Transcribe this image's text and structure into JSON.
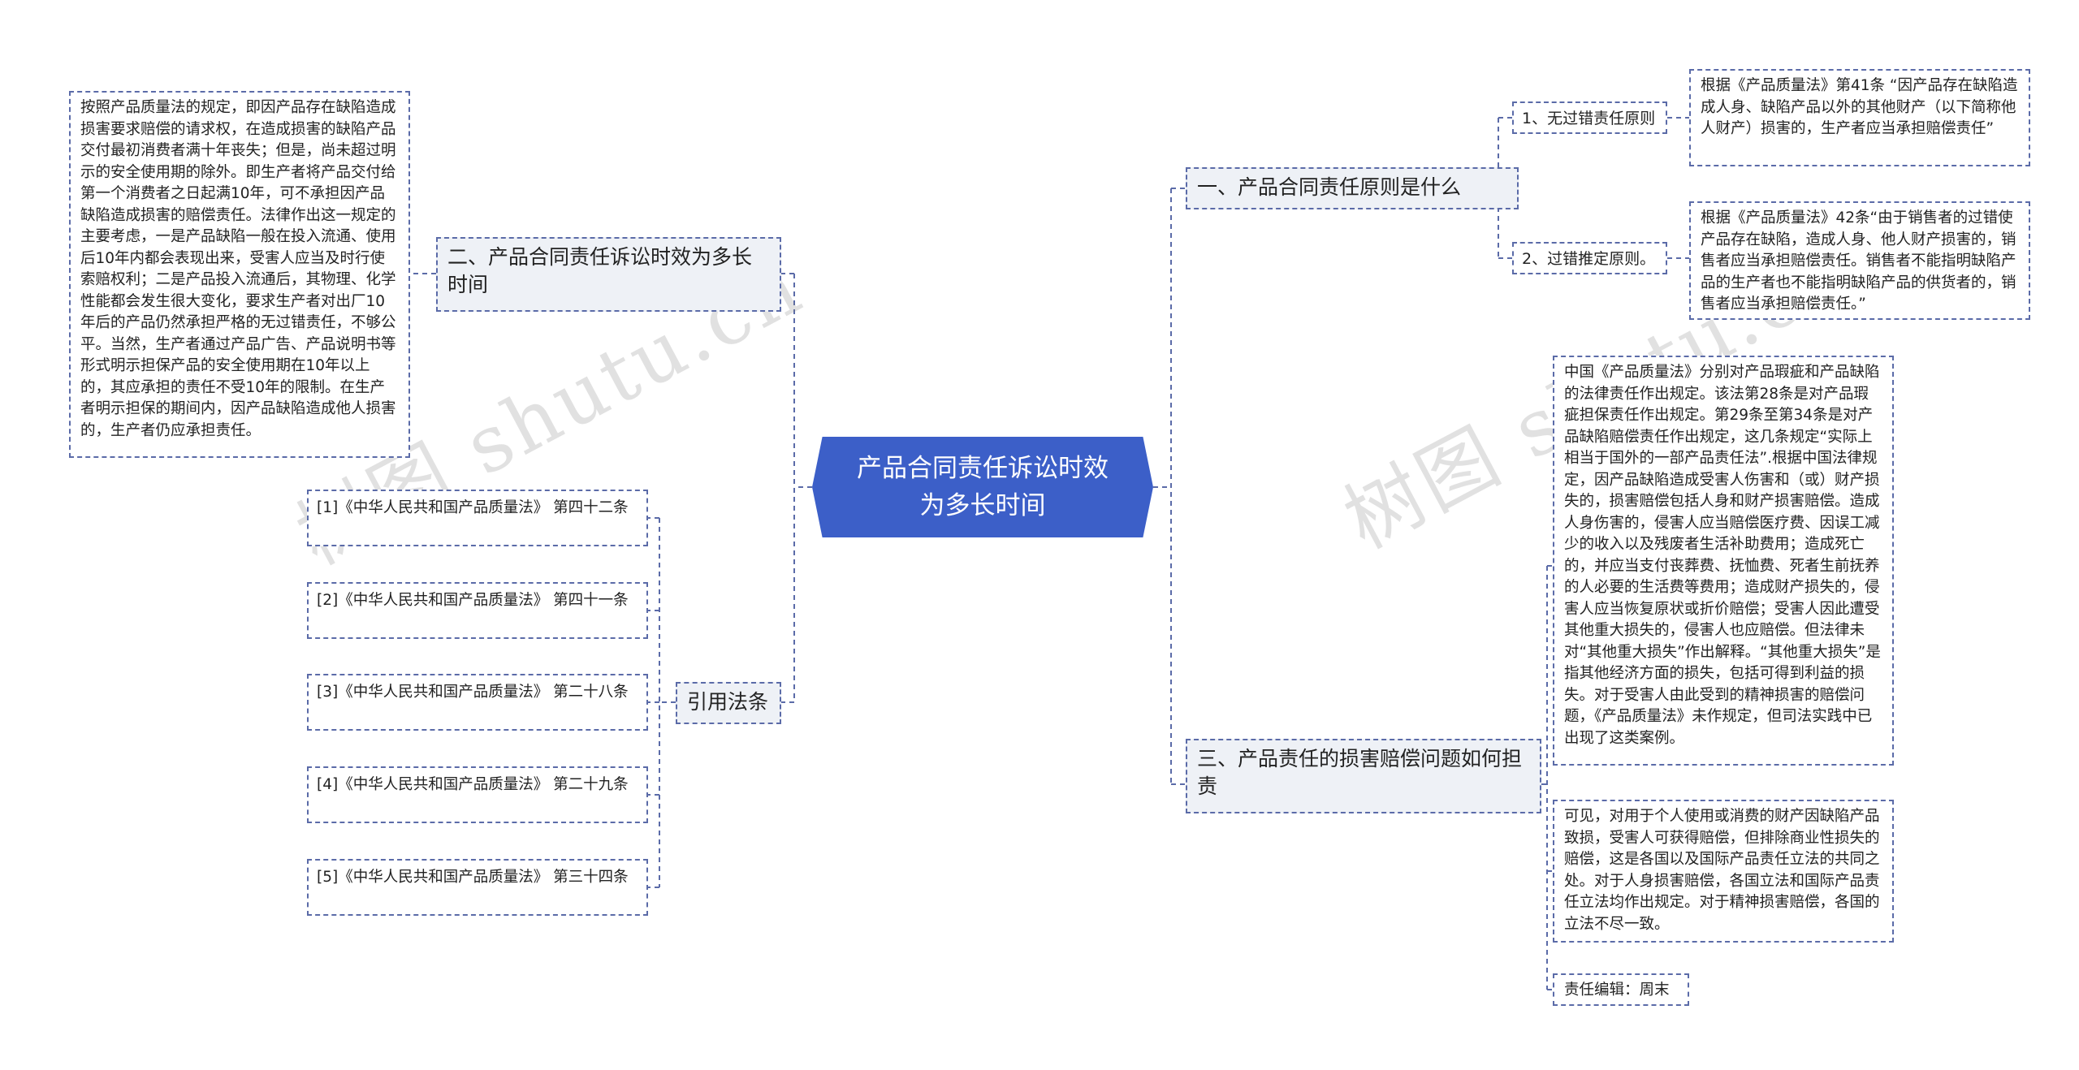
{
  "central": {
    "title": "产品合同责任诉讼时效为多长时间"
  },
  "branches": {
    "b1": {
      "label": "一、产品合同责任原则是什么",
      "children": [
        {
          "label": "1、无过错责任原则",
          "detail": "根据《产品质量法》第41条 “因产品存在缺陷造成人身、缺陷产品以外的其他财产（以下简称他人财产）损害的，生产者应当承担赔偿责任”"
        },
        {
          "label": "2、过错推定原则。",
          "detail": "根据《产品质量法》42条“由于销售者的过错使产品存在缺陷，造成人身、他人财产损害的，销售者应当承担赔偿责任。销售者不能指明缺陷产品的生产者也不能指明缺陷产品的供货者的，销售者应当承担赔偿责任。”"
        }
      ]
    },
    "b2": {
      "label": "二、产品合同责任诉讼时效为多长时间",
      "detail": "按照产品质量法的规定，即因产品存在缺陷造成损害要求赔偿的请求权，在造成损害的缺陷产品交付最初消费者满十年丧失；但是，尚未超过明示的安全使用期的除外。即生产者将产品交付给第一个消费者之日起满10年，可不承担因产品缺陷造成损害的赔偿责任。法律作出这一规定的主要考虑，一是产品缺陷一般在投入流通、使用后10年内都会表现出来，受害人应当及时行使索赔权利；二是产品投入流通后，其物理、化学性能都会发生很大变化，要求生产者对出厂10年后的产品仍然承担严格的无过错责任，不够公平。当然，生产者通过产品广告、产品说明书等形式明示担保产品的安全使用期在10年以上的，其应承担的责任不受10年的限制。在生产者明示担保的期间内，因产品缺陷造成他人损害的，生产者仍应承担责任。"
    },
    "b3": {
      "label": "三、产品责任的损害赔偿问题如何担责",
      "children": [
        "中国《产品质量法》分别对产品瑕疵和产品缺陷的法律责任作出规定。该法第28条是对产品瑕疵担保责任作出规定。第29条至第34条是对产品缺陷赔偿责任作出规定，这几条规定“实际上相当于国外的一部产品责任法”.根据中国法律规定，因产品缺陷造成受害人伤害和（或）财产损失的，损害赔偿包括人身和财产损害赔偿。造成人身伤害的，侵害人应当赔偿医疗费、因误工减少的收入以及残废者生活补助费用；造成死亡的，并应当支付丧葬费、抚恤费、死者生前抚养的人必要的生活费等费用；造成财产损失的，侵害人应当恢复原状或折价赔偿；受害人因此遭受其他重大损失的，侵害人也应赔偿。但法律未对“其他重大损失”作出解释。“其他重大损失”是指其他经济方面的损失，包括可得到利益的损失。对于受害人由此受到的精神损害的赔偿问题，《产品质量法》未作规定，但司法实践中已出现了这类案例。",
        "可见，对用于个人使用或消费的财产因缺陷产品致损，受害人可获得赔偿，但排除商业性损失的赔偿，这是各国以及国际产品责任立法的共同之处。对于人身损害赔偿，各国立法和国际产品责任立法均作出规定。对于精神损害赔偿，各国的立法不尽一致。",
        "责任编辑：周末"
      ]
    },
    "b4": {
      "label": "引用法条",
      "children": [
        "[1]《中华人民共和国产品质量法》 第四十二条",
        "[2]《中华人民共和国产品质量法》 第四十一条",
        "[3]《中华人民共和国产品质量法》 第二十八条",
        "[4]《中华人民共和国产品质量法》 第二十九条",
        "[5]《中华人民共和国产品质量法》 第三十四条"
      ]
    }
  },
  "watermarks": [
    "树图 shutu.cn",
    "树图 shutu.cn"
  ],
  "colors": {
    "central": "#3c5fc8",
    "branch_bg": "#eef1f6",
    "line": "#5b6ba8"
  }
}
